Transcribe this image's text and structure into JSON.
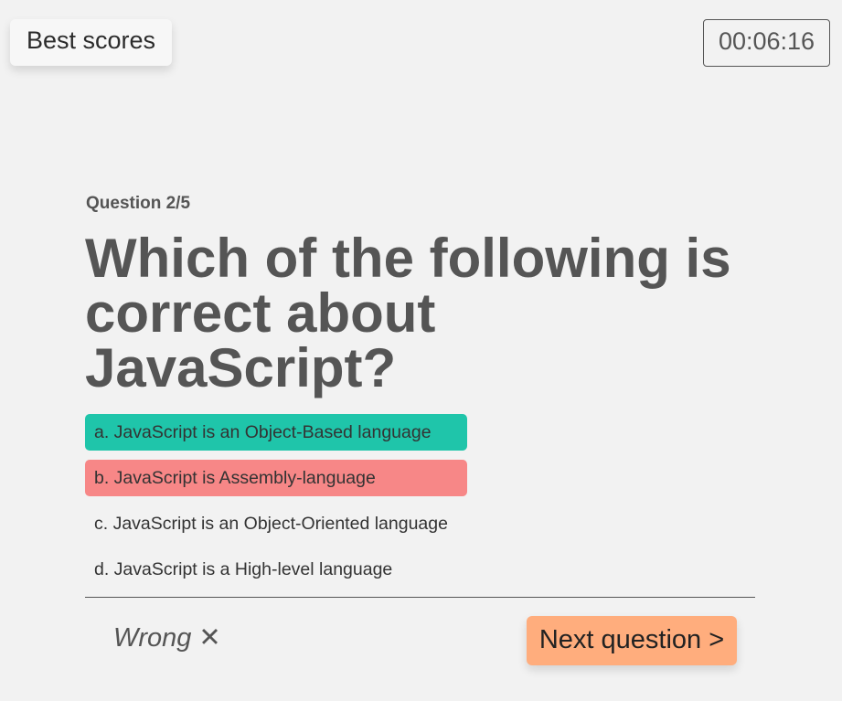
{
  "header": {
    "best_scores_label": "Best scores",
    "timer": "00:06:16"
  },
  "question": {
    "counter": "Question 2/5",
    "title": "Which of the following is correct about JavaScript?"
  },
  "answers": [
    {
      "label": "a. JavaScript is an Object-Based language",
      "state": "correct"
    },
    {
      "label": "b. JavaScript is Assembly-language",
      "state": "wrong"
    },
    {
      "label": "c. JavaScript is an Object-Oriented language",
      "state": "neutral"
    },
    {
      "label": "d. JavaScript is a High-level language",
      "state": "neutral"
    }
  ],
  "footer": {
    "result_text": "Wrong",
    "result_icon": "✕",
    "next_label": "Next question >"
  },
  "colors": {
    "background": "#f2f2f2",
    "correct": "#1fc5aa",
    "wrong": "#f78787",
    "next_button": "#ffad7d",
    "text_muted": "#555555"
  }
}
